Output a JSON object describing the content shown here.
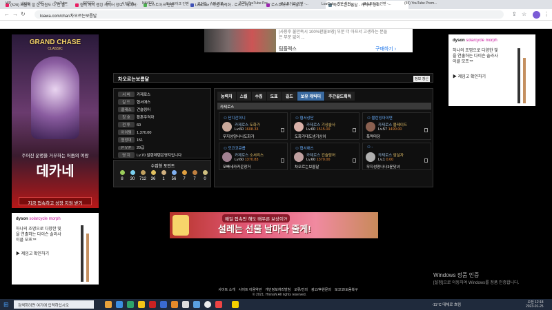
{
  "browser": {
    "tabs": [
      {
        "label": "(528) 싸움의 잘 한 회원도 다 안 올...",
        "color": "#e91e63"
      },
      {
        "label": "협력 캐릭 랭킹 캐릭터 정보 - 네이버 블로...",
        "color": "#e91e63"
      },
      {
        "label": "로스트아크 인벤",
        "color": "#4caf50"
      },
      {
        "label": "LoaCalc : 각인 최적화 - 로스트아크...",
        "color": "#3f51b5"
      },
      {
        "label": "로스트아크 - 커뮤니",
        "color": "#9c27b0"
      },
      {
        "label": "차오르는보름달 - 캐릭터 정보",
        "color": "#607d8b"
      }
    ],
    "url": "loawa.com/char/차오르는보름달",
    "bookmarks": [
      "WP",
      "네이버",
      "NC",
      "YouTube",
      "SPEED",
      "GT",
      "서치콘솔",
      "NAVER",
      "로스트아크 인벤",
      "로아와 : 슈퍼 정보...",
      "(528) YouTube Pre...",
      "로스트아크 인벤 -...",
      "LoaCalc : 각인 최적...",
      "로스트아크 인벤 -...",
      "(55) YouTube Prem..."
    ]
  },
  "ads": {
    "top_banner_text": "[사용후 불만족시 100%환불보장] 부분 더 아프서 고생하는 분들은 부분 없이 ...",
    "top_banner_brand": "팀플렉스",
    "top_banner_cta": "구매하기",
    "left_game_title": "GRAND CHASE",
    "left_game_sub": "CLASSIC",
    "left_game_tagline": "주어진 운명을 거부하는 어둠의 여왕",
    "left_game_name": "데카네",
    "left_game_cta": "지금 접속하고 성장 지원 받기",
    "dyson_brand": "dyson",
    "dyson_product": "solarcycle morph",
    "dyson_text": "하나의 조명으로 다양한 빛을 연출하는 다이슨 솔라사이클 모프™",
    "dyson_cta": "제임고 확인하기",
    "bottom_banner_top": "매일 접속만 해도 배우른 보상이?!",
    "bottom_banner_main": "설레는 선물 날마다 줄게!"
  },
  "character": {
    "name": "차오르는보름달",
    "refresh_label": "정보 갱신",
    "info": [
      {
        "k": "서 버",
        "v": "카제로스"
      },
      {
        "k": "길 드",
        "v": "협서애스"
      },
      {
        "k": "클래스",
        "v": "건슬링어"
      },
      {
        "k": "칭 호",
        "v": "황혼주격자"
      },
      {
        "k": "전 투",
        "v": "60"
      },
      {
        "k": "아이템",
        "v": "1,370.00"
      },
      {
        "k": "원정대",
        "v": "151"
      },
      {
        "k": "P V P",
        "v": "20급"
      },
      {
        "k": "영 지",
        "v": "Lv.70 발렌데텐은영지입니다"
      }
    ],
    "collection_title": "수집형 포인트",
    "collection_values": [
      "8",
      "30",
      "712",
      "36",
      "1",
      "56",
      "7",
      "7",
      "0"
    ],
    "tabs": [
      "능력치",
      "스킬",
      "수집",
      "도표",
      "길드",
      "보유 캐릭터",
      "주간골드획득"
    ],
    "active_tab": "보유 캐릭터",
    "server_header": "카제로스",
    "cards": [
      {
        "guild": "단디간이니",
        "server": "카제로스",
        "cls": "도화가",
        "lv": "Lv.60",
        "ilvl": "1608.33",
        "name": "무지성양나나도화가"
      },
      {
        "guild": "협서상단",
        "server": "카제로스",
        "cls": "기상술사",
        "lv": "Lv.60",
        "ilvl": "1515.00",
        "name": "도화가대도생기상이"
      },
      {
        "guild": "블란잉아이연",
        "server": "카제로스",
        "cls": "블레이드",
        "lv": "Lv.57",
        "ilvl": "1490.00",
        "name": "폭력마당"
      },
      {
        "guild": "모코코큐룹",
        "server": "카제로스",
        "cls": "소서리스",
        "lv": "Lv.60",
        "ilvl": "1370.83",
        "name": "모빠네카카운장거"
      },
      {
        "guild": "협서애스",
        "server": "카제로스",
        "cls": "건슬링어",
        "lv": "Lv.60",
        "ilvl": "1370.00",
        "name": "차오르는보름달"
      },
      {
        "guild": "-",
        "server": "카제로스",
        "cls": "암살자",
        "lv": "Lv.1",
        "ilvl": "0.00",
        "name": "무지성양나나3윤닷녀"
      }
    ]
  },
  "footer": {
    "links": [
      "사이트 소개",
      "사이트 이용약관",
      "개인정보처리방침",
      "오류/건의",
      "광고/후원문의",
      "모코코/도움복구"
    ],
    "copyright": "© 2021. HninaN All rights reserved."
  },
  "windows": {
    "watermark_title": "Windows 정품 인증",
    "watermark_sub": "[설정]으로 이동하여 Windows를 정품 인증합니다.",
    "search_placeholder": "검색하려면 여기에 입력하십시오",
    "weather": "-11°C 대체로 흐림",
    "time": "오전 12:18",
    "date": "2023-01-25"
  }
}
